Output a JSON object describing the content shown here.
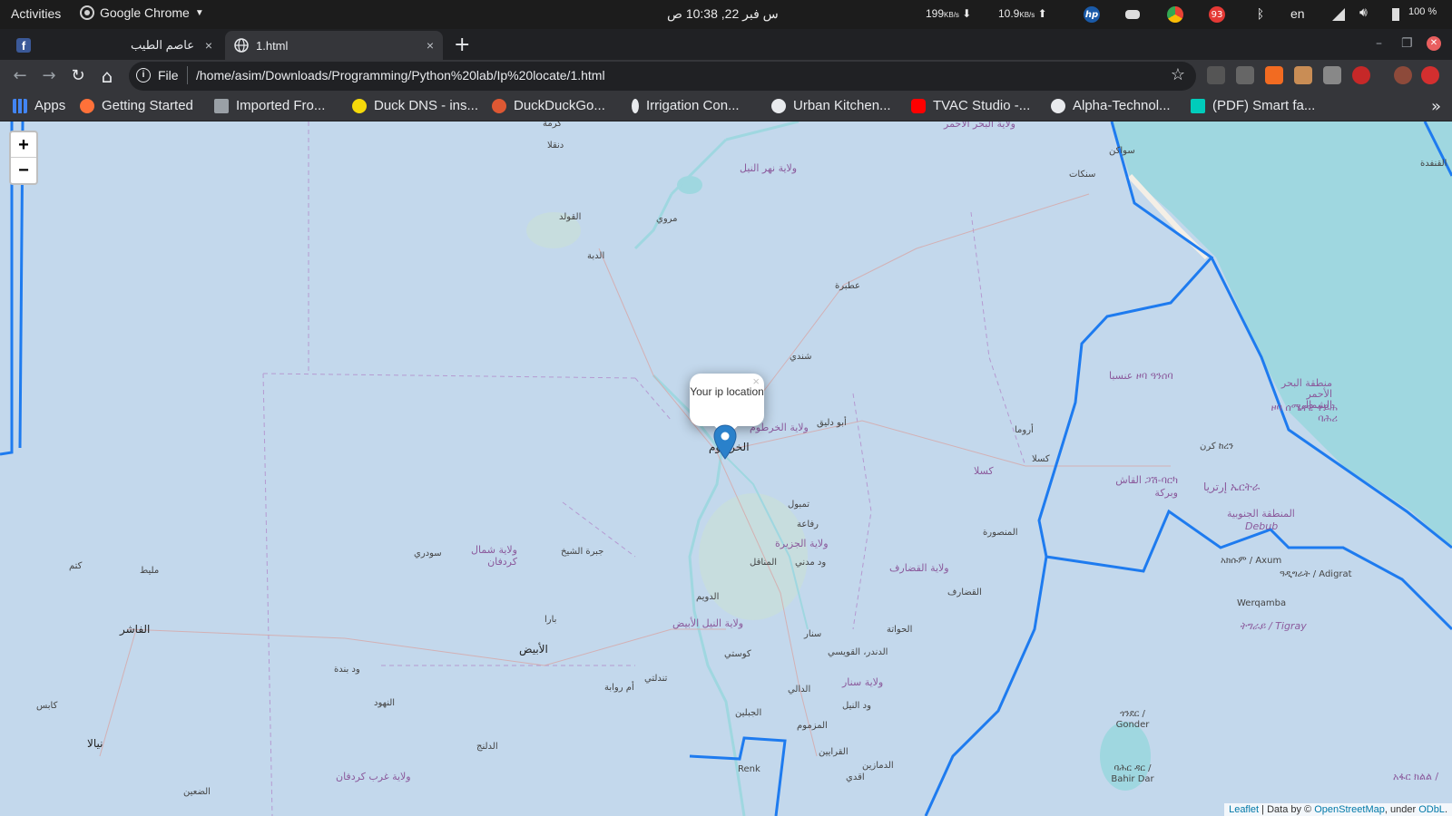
{
  "topbar": {
    "activities": "Activities",
    "app_name": "Google Chrome",
    "clock": "س فبر 22, 10:38 ص",
    "net_down_value": "199",
    "net_up_value": "10.9",
    "unit": "KB/s",
    "down_arrow": "⬇",
    "up_arrow": "⬆",
    "badge_count": "93",
    "lang": "en",
    "battery": "100 %"
  },
  "tabs": [
    {
      "title": "عاصم الطيب",
      "close": "×"
    },
    {
      "title": "1.html",
      "close": "×"
    }
  ],
  "new_tab": "+",
  "window_controls": {
    "minimize": "–",
    "restore": "❐",
    "close": "✕"
  },
  "toolbar": {
    "back": "←",
    "forward": "→",
    "reload": "↻",
    "home": "⌂",
    "info": "i",
    "scheme": "File",
    "url": "/home/asim/Downloads/Programming/Python%20lab/Ip%20locate/1.html",
    "star": "☆"
  },
  "bookmarks": [
    {
      "label": "Apps",
      "icon": "apps-grid-icon",
      "color": "#4285f4"
    },
    {
      "label": "Getting Started",
      "icon": "firefox-icon",
      "color": "#ff7139"
    },
    {
      "label": "Imported Fro...",
      "icon": "folder-icon",
      "color": "#9aa0a6"
    },
    {
      "label": "Duck DNS - ins...",
      "icon": "duck-icon",
      "color": "#f5d90a"
    },
    {
      "label": "DuckDuckGo...",
      "icon": "duckduckgo-icon",
      "color": "#de5833"
    },
    {
      "label": "Irrigation Con...",
      "icon": "irrigation-icon",
      "color": "#e8eaed"
    },
    {
      "label": "Urban Kitchen...",
      "icon": "globe-icon",
      "color": "#e8eaed"
    },
    {
      "label": "TVAC Studio -...",
      "icon": "youtube-icon",
      "color": "#ff0000"
    },
    {
      "label": "Alpha-Technol...",
      "icon": "github-icon",
      "color": "#e8eaed"
    },
    {
      "label": "(PDF) Smart fa...",
      "icon": "researchgate-icon",
      "color": "#00ccbb"
    }
  ],
  "bookmarks_more": "»",
  "map": {
    "zoom_in": "+",
    "zoom_out": "−",
    "popup_text": "Your ip location",
    "popup_close": "×",
    "attribution_leaflet": "Leaflet",
    "attribution_mid": " | Data by © ",
    "attribution_osm": "OpenStreetMap",
    "attribution_under": ", under ",
    "attribution_odbl": "ODbL",
    "attribution_end": ".",
    "places": {
      "karima": "كرمة",
      "dongola": "دنقلا",
      "nile_state": "ولاية نهر النيل",
      "red_sea_state": "ولاية البحر الأحمر",
      "port_sudan": "سواكن",
      "sinkat": "سنكات",
      "qolqad": "القنفدة",
      "golid": "القولد",
      "merowe": "مروي",
      "debba": "الدبة",
      "atbara": "عطبرة",
      "shendi": "شندي",
      "khartoum_state": "ولاية الخرطوم",
      "abu_deleig": "أبو دليق",
      "khartoum": "الخرطوم",
      "aroma": "أروما",
      "kassala": "كسلا",
      "kassala_state": "كسلا",
      "anseba": "ዞባ ዓንሰባ عنسبا",
      "north_red_sea": "منطقة البحر الأحمر الشمالي",
      "north_red_sea_tig": "ዞባ ሰሜናዊ ቀይሕ ባሕሪ",
      "keren": "ከረን كرن",
      "gash_barka": "ጋሽ-ባርካ القاش وبركة",
      "eritrea": "ኤርትራ إرتريا",
      "southern_region": "المنطقة الجنوبية",
      "debub": "Debub",
      "tamboul": "تمبول",
      "rufaa": "رفاعة",
      "mansoura": "المنصورة",
      "gezira_state": "ولاية الجزيرة",
      "managil": "المناقل",
      "wad_madani": "ود مدني",
      "gedaref_state": "ولاية القضارف",
      "gedaref": "القضارف",
      "axum": "አክሱም / Axum",
      "adigrat": "ዓዲግራት / Adigrat",
      "werqamba": "Werqamba",
      "tigray": "ትግራይ / Tigray",
      "north_kordofan": "ولاية شمال كردفان",
      "sodiri": "سودري",
      "jabra": "جبرة الشيخ",
      "kutum": "كتم",
      "mellit": "مليط",
      "fasher": "الفاشر",
      "bara": "بارا",
      "obeid": "الأبيض",
      "duwaym": "الدويم",
      "white_nile_state": "ولاية النيل الأبيض",
      "hawata": "الحواتة",
      "sennar": "سنار",
      "dinder": "الدندر، القويسي",
      "kosti": "كوستي",
      "tendalti": "تندلتي",
      "um_rawaba": "أم روابة",
      "wad_banda": "ود بندة",
      "nahud": "النهود",
      "kabkabiya": "كابس",
      "nyala": "نيالا",
      "sennar_state": "ولاية سنار",
      "dali": "الدالي",
      "wad_nil": "ود النيل",
      "jebelein": "الجبلين",
      "mazmum": "المزموم",
      "gondar": "ጎንደር / Gonder",
      "dilling": "الدلنج",
      "west_kordofan": "ولاية غرب كردفان",
      "renk": "Renk",
      "gerayen": "القرايين",
      "damazin": "الدمازين",
      "agdi": "اقدي",
      "bahir_dar": "ባሕር ዳር / Bahir Dar",
      "daein": "الضعين",
      "afar": "አፋር ክልል /"
    }
  },
  "colors": {
    "map_bg": "#c3d8ec",
    "sea": "#9fd7e0",
    "border_blue": "#1e7bef",
    "marker": "#2a81cb"
  }
}
